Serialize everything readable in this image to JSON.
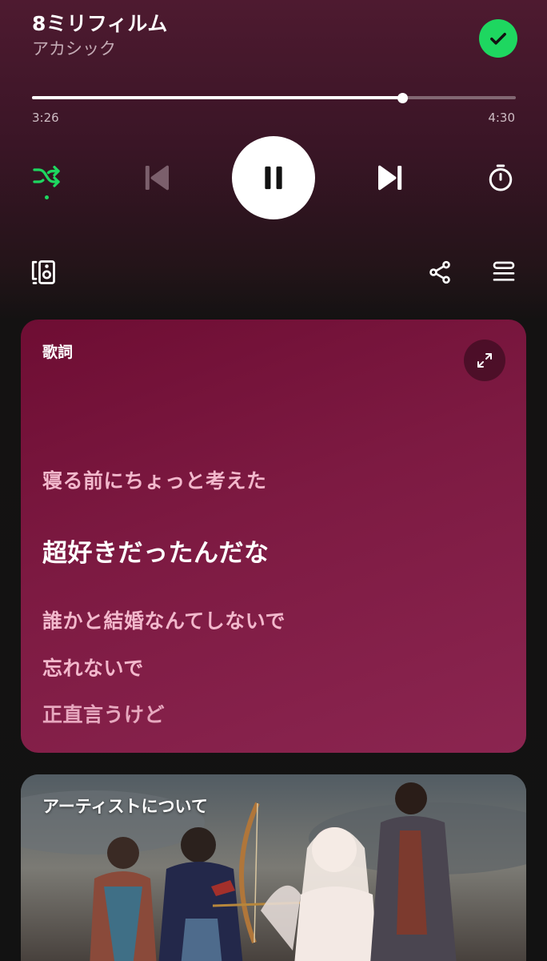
{
  "track": {
    "title": "8ミリフィルム",
    "artist": "アカシック"
  },
  "playback": {
    "elapsed": "3:26",
    "total": "4:30",
    "progress_fraction": 0.765,
    "is_playing": true,
    "shuffle_on": true,
    "liked": true
  },
  "icons": {
    "liked": "check-circle-icon",
    "shuffle": "shuffle-icon",
    "previous": "skip-previous-icon",
    "play_pause": "pause-icon",
    "next": "skip-next-icon",
    "sleep_timer": "timer-icon",
    "connect": "device-speaker-icon",
    "share": "share-icon",
    "queue": "queue-icon",
    "expand": "expand-icon"
  },
  "colors": {
    "accent": "#1ed760",
    "lyrics_card": "#7d1a42",
    "lyric_inactive": "#f2b8cc",
    "lyric_active": "#ffffff"
  },
  "lyrics": {
    "label": "歌詞",
    "lines": [
      {
        "text": "寝る前にちょっと考えた",
        "active": false
      },
      {
        "text": "超好きだったんだな",
        "active": true
      },
      {
        "text": "誰かと結婚なんてしないで",
        "active": false
      },
      {
        "text": "忘れないで",
        "active": false
      },
      {
        "text": "正直言うけど",
        "active": false
      }
    ]
  },
  "artist_section": {
    "label": "アーティストについて"
  }
}
